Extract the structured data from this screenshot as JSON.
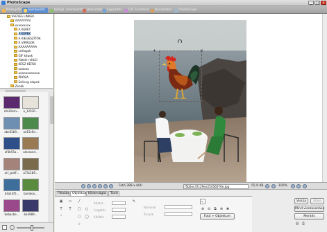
{
  "app": {
    "title": "PhotoScape"
  },
  "window": {
    "minimize": "_",
    "maximize": "□",
    "close": "x"
  },
  "tabs": [
    {
      "label": "Nézegető",
      "active": false,
      "color": "#f0b64a"
    },
    {
      "label": "Szerkesztő",
      "active": true,
      "color": "#f7d35a"
    },
    {
      "label": "Kötegl. Szerkesztő",
      "active": false,
      "color": "#8bc36b"
    },
    {
      "label": "Bemutató",
      "active": false,
      "color": "#d66c55"
    },
    {
      "label": "Egyesítés",
      "active": false,
      "color": "#6fa5d9"
    },
    {
      "label": "GIF animáció",
      "active": false,
      "color": "#c58cd6"
    },
    {
      "label": "Nyomtatás",
      "active": false,
      "color": "#d9a05b"
    },
    {
      "label": "PhotoScape",
      "active": false,
      "color": "#9fb7cf"
    }
  ],
  "tree": [
    {
      "label": "VEGYES LINKEK",
      "indent": 2
    },
    {
      "label": "VVVVVVVV",
      "indent": 3
    },
    {
      "label": "xxxxxxxxx",
      "indent": 3
    },
    {
      "label": "A KERET",
      "indent": 4
    },
    {
      "label": "A KÉPEK",
      "indent": 4,
      "selected": true
    },
    {
      "label": "A KIEGÉSZÍTŐK",
      "indent": 4
    },
    {
      "label": "A VIRÁGOK",
      "indent": 4
    },
    {
      "label": "AAAAAAAAA",
      "indent": 4
    },
    {
      "label": "csillagok",
      "indent": 4
    },
    {
      "label": "GIF képek",
      "indent": 4
    },
    {
      "label": "Háttér nélkül",
      "indent": 4
    },
    {
      "label": "KÉSZ KÉPEK",
      "indent": 4
    },
    {
      "label": "oooooo",
      "indent": 4
    },
    {
      "label": "oooooooooooo",
      "indent": 4
    },
    {
      "label": "PRÓBA",
      "indent": 4
    },
    {
      "label": "Szöveg alapok",
      "indent": 4
    },
    {
      "label": "Zenék",
      "indent": 3
    }
  ],
  "thumbnails": [
    {
      "caption": "a%20sziv...",
      "color": "#5b2a6e"
    },
    {
      "caption": "a_12030...",
      "color": "#e8e3da"
    },
    {
      "caption": "abe02b9...",
      "color": "#6f8fb2"
    },
    {
      "caption": "ae15c9e...",
      "color": "#4b8a4a"
    },
    {
      "caption": "af3b55a...",
      "color": "#2f4f8a"
    },
    {
      "caption": "alessand...",
      "color": "#9a7a52"
    },
    {
      "caption": "art_graff...",
      "color": "#a4847a"
    },
    {
      "caption": "a73c1b9...",
      "color": "#7a6b4c"
    },
    {
      "caption": "b4a14f0...",
      "color": "#3e6f9c"
    },
    {
      "caption": "bamboo...",
      "color": "#5a8a3c"
    },
    {
      "caption": "bebacbe...",
      "color": "#9a4a8a"
    },
    {
      "caption": "be3989...",
      "color": "#3a3a6a"
    }
  ],
  "status": {
    "photo_size": "Fotó 398 x 600",
    "filename": "f5b0ec47c29ee25456076e.jpg",
    "filesize": "55.9 KB",
    "zoom": "100%"
  },
  "edit_tabs": [
    "Főkódai",
    "Objektum",
    "Körbevágás",
    "Tools"
  ],
  "edit_labels": {
    "width": "Átlátsz...",
    "rotate": "Forgatás",
    "fill": "Kitöltés",
    "outline": "Körvonal",
    "shadow": "Árnyék",
    "photo_object": "Fotó + Objektum"
  },
  "buttons": {
    "undo": "Vissza",
    "redo": "Előre",
    "undo_all": "Mind visszavonása",
    "save": "Mentés"
  }
}
